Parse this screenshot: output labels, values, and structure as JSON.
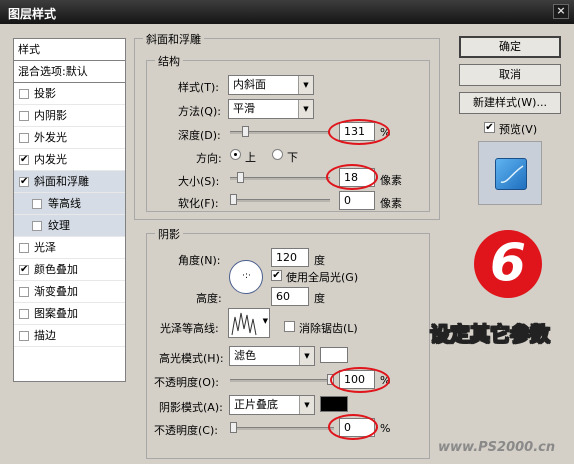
{
  "window": {
    "title": "图层样式",
    "close": "×"
  },
  "style_list": {
    "header": "样式",
    "blend_default": "混合选项:默认",
    "items": [
      {
        "label": "投影",
        "checked": false,
        "sub": false,
        "active": false
      },
      {
        "label": "内阴影",
        "checked": false,
        "sub": false,
        "active": false
      },
      {
        "label": "外发光",
        "checked": false,
        "sub": false,
        "active": false
      },
      {
        "label": "内发光",
        "checked": true,
        "sub": false,
        "active": false
      },
      {
        "label": "斜面和浮雕",
        "checked": true,
        "sub": false,
        "active": true
      },
      {
        "label": "等高线",
        "checked": false,
        "sub": true,
        "active": false
      },
      {
        "label": "纹理",
        "checked": false,
        "sub": true,
        "active": false
      },
      {
        "label": "光泽",
        "checked": false,
        "sub": false,
        "active": false
      },
      {
        "label": "颜色叠加",
        "checked": true,
        "sub": false,
        "active": false
      },
      {
        "label": "渐变叠加",
        "checked": false,
        "sub": false,
        "active": false
      },
      {
        "label": "图案叠加",
        "checked": false,
        "sub": false,
        "active": false
      },
      {
        "label": "描边",
        "checked": false,
        "sub": false,
        "active": false
      }
    ]
  },
  "check_mark": "✔",
  "bevel": {
    "title": "斜面和浮雕",
    "structure_title": "结构",
    "style_label": "样式(T):",
    "style_value": "内斜面",
    "technique_label": "方法(Q):",
    "technique_value": "平滑",
    "depth_label": "深度(D):",
    "depth_value": "131",
    "depth_unit": "%",
    "depth_slider": 0.13,
    "direction_label": "方向:",
    "dir_up": "上",
    "dir_down": "下",
    "size_label": "大小(S):",
    "size_value": "18",
    "size_unit": "像素",
    "size_slider": 0.07,
    "soften_label": "软化(F):",
    "soften_value": "0",
    "soften_unit": "像素",
    "soften_slider": 0.0,
    "arrow": "▼"
  },
  "shading": {
    "title": "阴影",
    "angle_label": "角度(N):",
    "angle_value": "120",
    "angle_unit": "度",
    "global_light": "使用全局光(G)",
    "altitude_label": "高度:",
    "altitude_value": "60",
    "altitude_unit": "度",
    "gloss_label": "光泽等高线:",
    "antialias": "消除锯齿(L)",
    "highlight_mode_label": "高光模式(H):",
    "highlight_mode": "滤色",
    "highlight_color": "#ffffff",
    "opacity1_label": "不透明度(O):",
    "opacity1_value": "100",
    "opacity1_unit": "%",
    "opacity1_slider": 1.0,
    "shadow_mode_label": "阴影模式(A):",
    "shadow_mode": "正片叠底",
    "shadow_color": "#000000",
    "opacity2_label": "不透明度(C):",
    "opacity2_value": "0",
    "opacity2_unit": "%",
    "opacity2_slider": 0.0
  },
  "buttons": {
    "ok": "确定",
    "cancel": "取消",
    "new_style": "新建样式(W)...",
    "preview": "预览(V)"
  },
  "overlay": {
    "step": "6",
    "caption": "设定其它参数",
    "watermark": "www.PS2000.cn"
  },
  "colors": {
    "annotation_red": "#e0141b",
    "preview_blue": "#2b8fd6"
  }
}
